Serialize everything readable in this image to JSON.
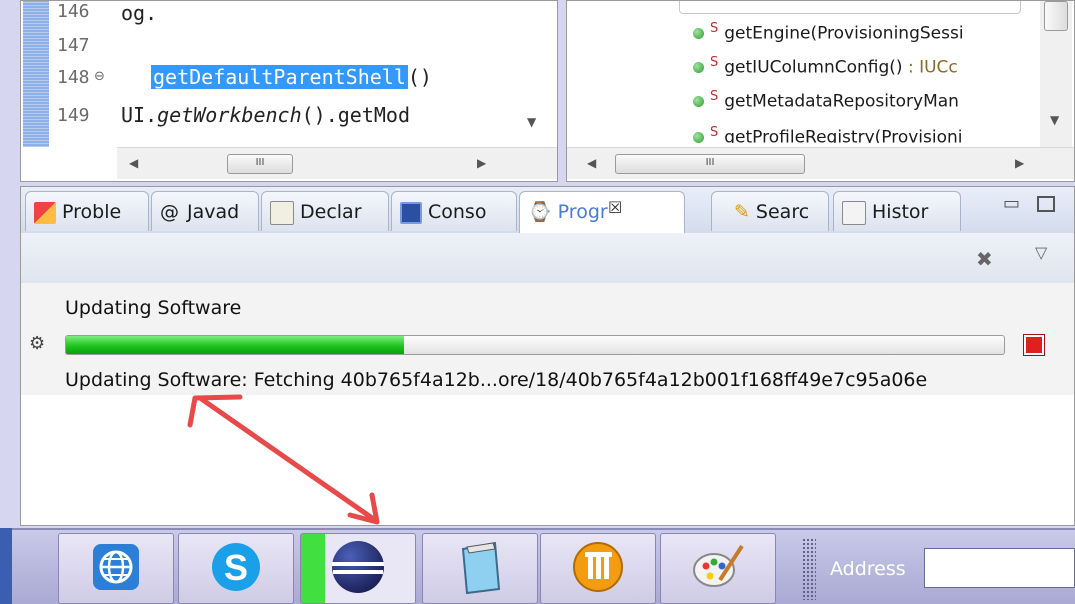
{
  "editor": {
    "line_numbers": [
      "146",
      "147",
      "148",
      "149"
    ],
    "code_lines": {
      "line146": "og.",
      "line148_selected": "getDefaultParentShell",
      "line148_rest": "()",
      "line149_a": "UI.",
      "line149_italic": "getWorkbench",
      "line149_b": "().getMod"
    },
    "scroll_thumb_label": "III"
  },
  "outline": {
    "items": [
      {
        "name": "getEngine(ProvisioningSessi",
        "type": ""
      },
      {
        "name": "getIUColumnConfig()",
        "type": " : IUCc"
      },
      {
        "name": "getMetadataRepositoryMan",
        "type": ""
      },
      {
        "name": "getProfileRegistry(Provisioni",
        "type": ""
      }
    ],
    "static_marker": "S",
    "scroll_thumb_label": "III"
  },
  "bottom_view": {
    "tabs": [
      {
        "label": "Proble",
        "icon": "problems-icon"
      },
      {
        "label": "Javad",
        "icon": "javadoc-icon"
      },
      {
        "label": "Declar",
        "icon": "declaration-icon"
      },
      {
        "label": "Conso",
        "icon": "console-icon"
      },
      {
        "label": "Progr",
        "icon": "progress-icon"
      },
      {
        "label": "Searc",
        "icon": "search-icon"
      },
      {
        "label": "Histor",
        "icon": "history-icon"
      }
    ],
    "active_tab": "Progr",
    "close_glyph": "☒"
  },
  "progress": {
    "job_title": "Updating Software",
    "job_detail": "Updating Software: Fetching 40b765f4a12b...ore/18/40b765f4a12b001f168ff49e7c95a06e",
    "percent": 36,
    "fill_color": "#1fc41f",
    "cancel_color": "#e21f1f"
  },
  "taskbar": {
    "buttons": [
      "globe-browser-icon",
      "skype-icon",
      "eclipse-icon",
      "notepad-icon",
      "office-icon",
      "paint-icon"
    ],
    "address_label": "Address"
  },
  "annotation": {
    "arrow_color": "#e84a4a"
  }
}
